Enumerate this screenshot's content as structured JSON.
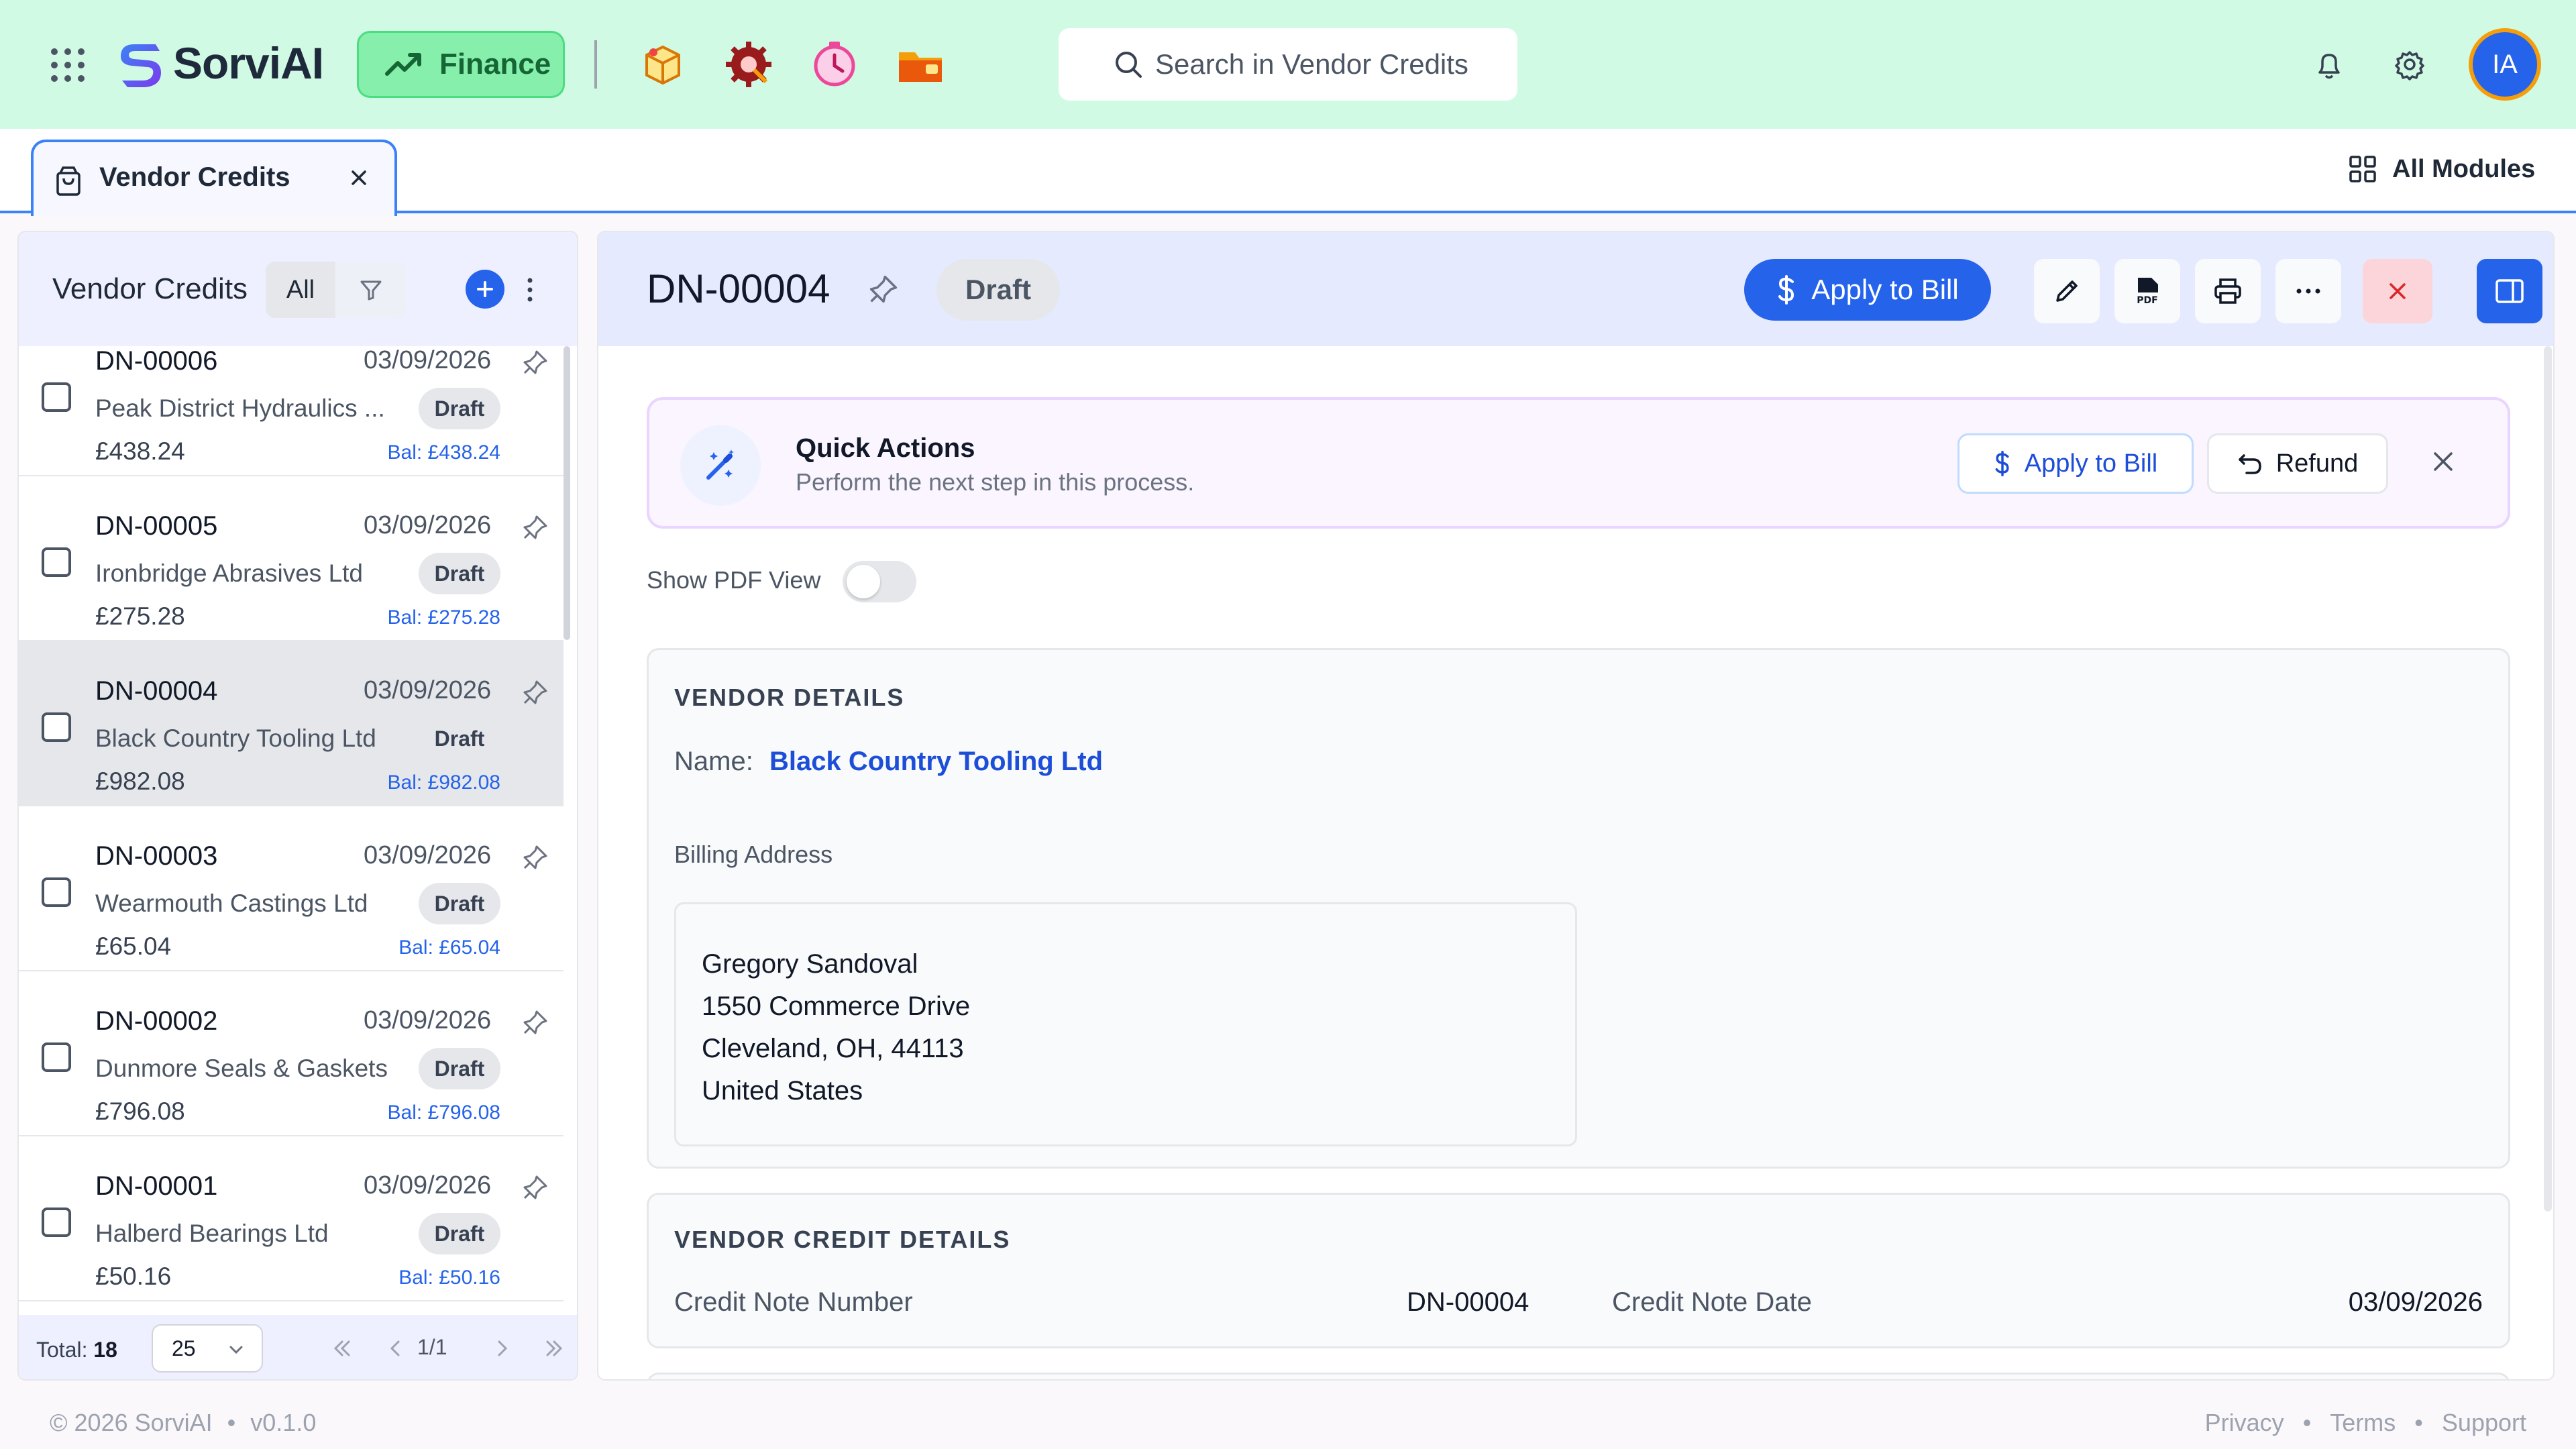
{
  "app": {
    "name": "SorviAI",
    "module": "Finance",
    "search_placeholder": "Search in Vendor Credits",
    "user_initials": "IA",
    "colors": {
      "accent": "#2563eb",
      "topbar": "#d1fae5",
      "finance": "#86efac"
    }
  },
  "tabs": {
    "active": "Vendor Credits",
    "all_modules": "All Modules"
  },
  "list": {
    "title": "Vendor Credits",
    "filter": "All",
    "items": [
      {
        "number": "DN-00006",
        "date": "03/09/2026",
        "vendor": "Peak District Hydraulics ...",
        "status": "Draft",
        "amount": "£438.24",
        "balance": "Bal: £438.24"
      },
      {
        "number": "DN-00005",
        "date": "03/09/2026",
        "vendor": "Ironbridge Abrasives Ltd",
        "status": "Draft",
        "amount": "£275.28",
        "balance": "Bal: £275.28"
      },
      {
        "number": "DN-00004",
        "date": "03/09/2026",
        "vendor": "Black Country Tooling Ltd",
        "status": "Draft",
        "amount": "£982.08",
        "balance": "Bal: £982.08"
      },
      {
        "number": "DN-00003",
        "date": "03/09/2026",
        "vendor": "Wearmouth Castings Ltd",
        "status": "Draft",
        "amount": "£65.04",
        "balance": "Bal: £65.04"
      },
      {
        "number": "DN-00002",
        "date": "03/09/2026",
        "vendor": "Dunmore Seals & Gaskets",
        "status": "Draft",
        "amount": "£796.08",
        "balance": "Bal: £796.08"
      },
      {
        "number": "DN-00001",
        "date": "03/09/2026",
        "vendor": "Halberd Bearings Ltd",
        "status": "Draft",
        "amount": "£50.16",
        "balance": "Bal: £50.16"
      }
    ],
    "total_label": "Total:",
    "total_value": "18",
    "per_page": "25",
    "page": "1/1"
  },
  "detail": {
    "number": "DN-00004",
    "status": "Draft",
    "apply_label": "Apply to Bill",
    "quick_actions": {
      "title": "Quick Actions",
      "subtitle": "Perform the next step in this process.",
      "apply_label": "Apply to Bill",
      "refund_label": "Refund"
    },
    "pdf_toggle_label": "Show PDF View",
    "pdf_toggle_on": false,
    "vendor_details": {
      "heading": "VENDOR DETAILS",
      "name_label": "Name:",
      "name": "Black Country Tooling Ltd",
      "billing_label": "Billing Address",
      "address": [
        "Gregory Sandoval",
        "1550 Commerce Drive",
        "Cleveland, OH, 44113",
        "United States"
      ]
    },
    "credit_details": {
      "heading": "VENDOR CREDIT DETAILS",
      "number_label": "Credit Note Number",
      "number": "DN-00004",
      "date_label": "Credit Note Date",
      "date": "03/09/2026"
    }
  },
  "footer": {
    "copyright": "© 2026 SorviAI",
    "version": "v0.1.0",
    "links": [
      "Privacy",
      "Terms",
      "Support"
    ]
  }
}
